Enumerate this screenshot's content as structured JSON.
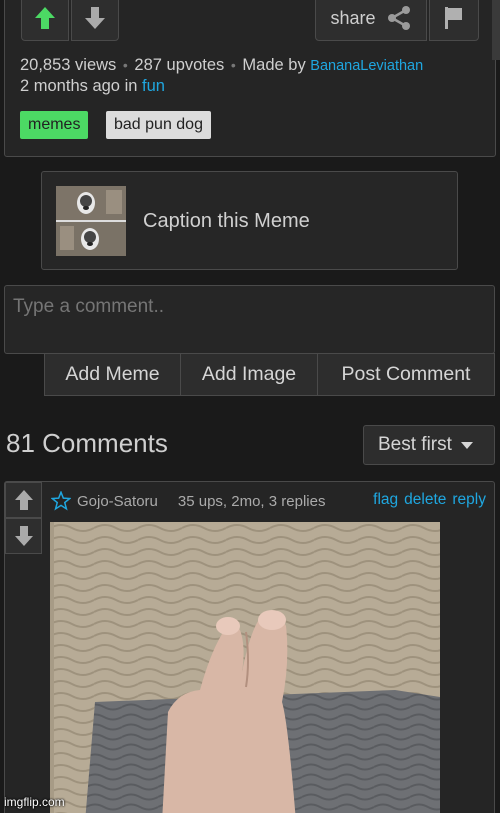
{
  "post": {
    "share_label": "share",
    "views": "20,853 views",
    "upvotes": "287 upvotes",
    "made_by_prefix": "Made by",
    "author": "BananaLeviathan",
    "time_prefix": "2 months ago in",
    "stream": "fun",
    "tags": [
      "memes",
      "bad pun dog"
    ]
  },
  "caption": {
    "label": "Caption this Meme"
  },
  "comment_form": {
    "placeholder": "Type a comment..",
    "add_meme": "Add Meme",
    "add_image": "Add Image",
    "post_comment": "Post Comment"
  },
  "comments": {
    "count_label": "81 Comments",
    "sort_value": "Best first",
    "items": [
      {
        "author": "Gojo-Satoru",
        "meta": "35 ups, 2mo, 3 replies",
        "actions": [
          "flag",
          "delete",
          "reply"
        ]
      }
    ]
  },
  "watermark": "imgflip.com",
  "colors": {
    "background": "#1a1a1a",
    "panel": "#252525",
    "link": "#1fa7e0",
    "upvote_active": "#4cd964",
    "tag_memes": "#4cd964",
    "tag_default": "#dcdcdc"
  },
  "icons": {
    "upvote": "arrow-up-icon",
    "downvote": "arrow-down-icon",
    "share": "share-icon",
    "flag": "flag-icon",
    "sort": "caret-down-icon",
    "user": "star-icon"
  }
}
